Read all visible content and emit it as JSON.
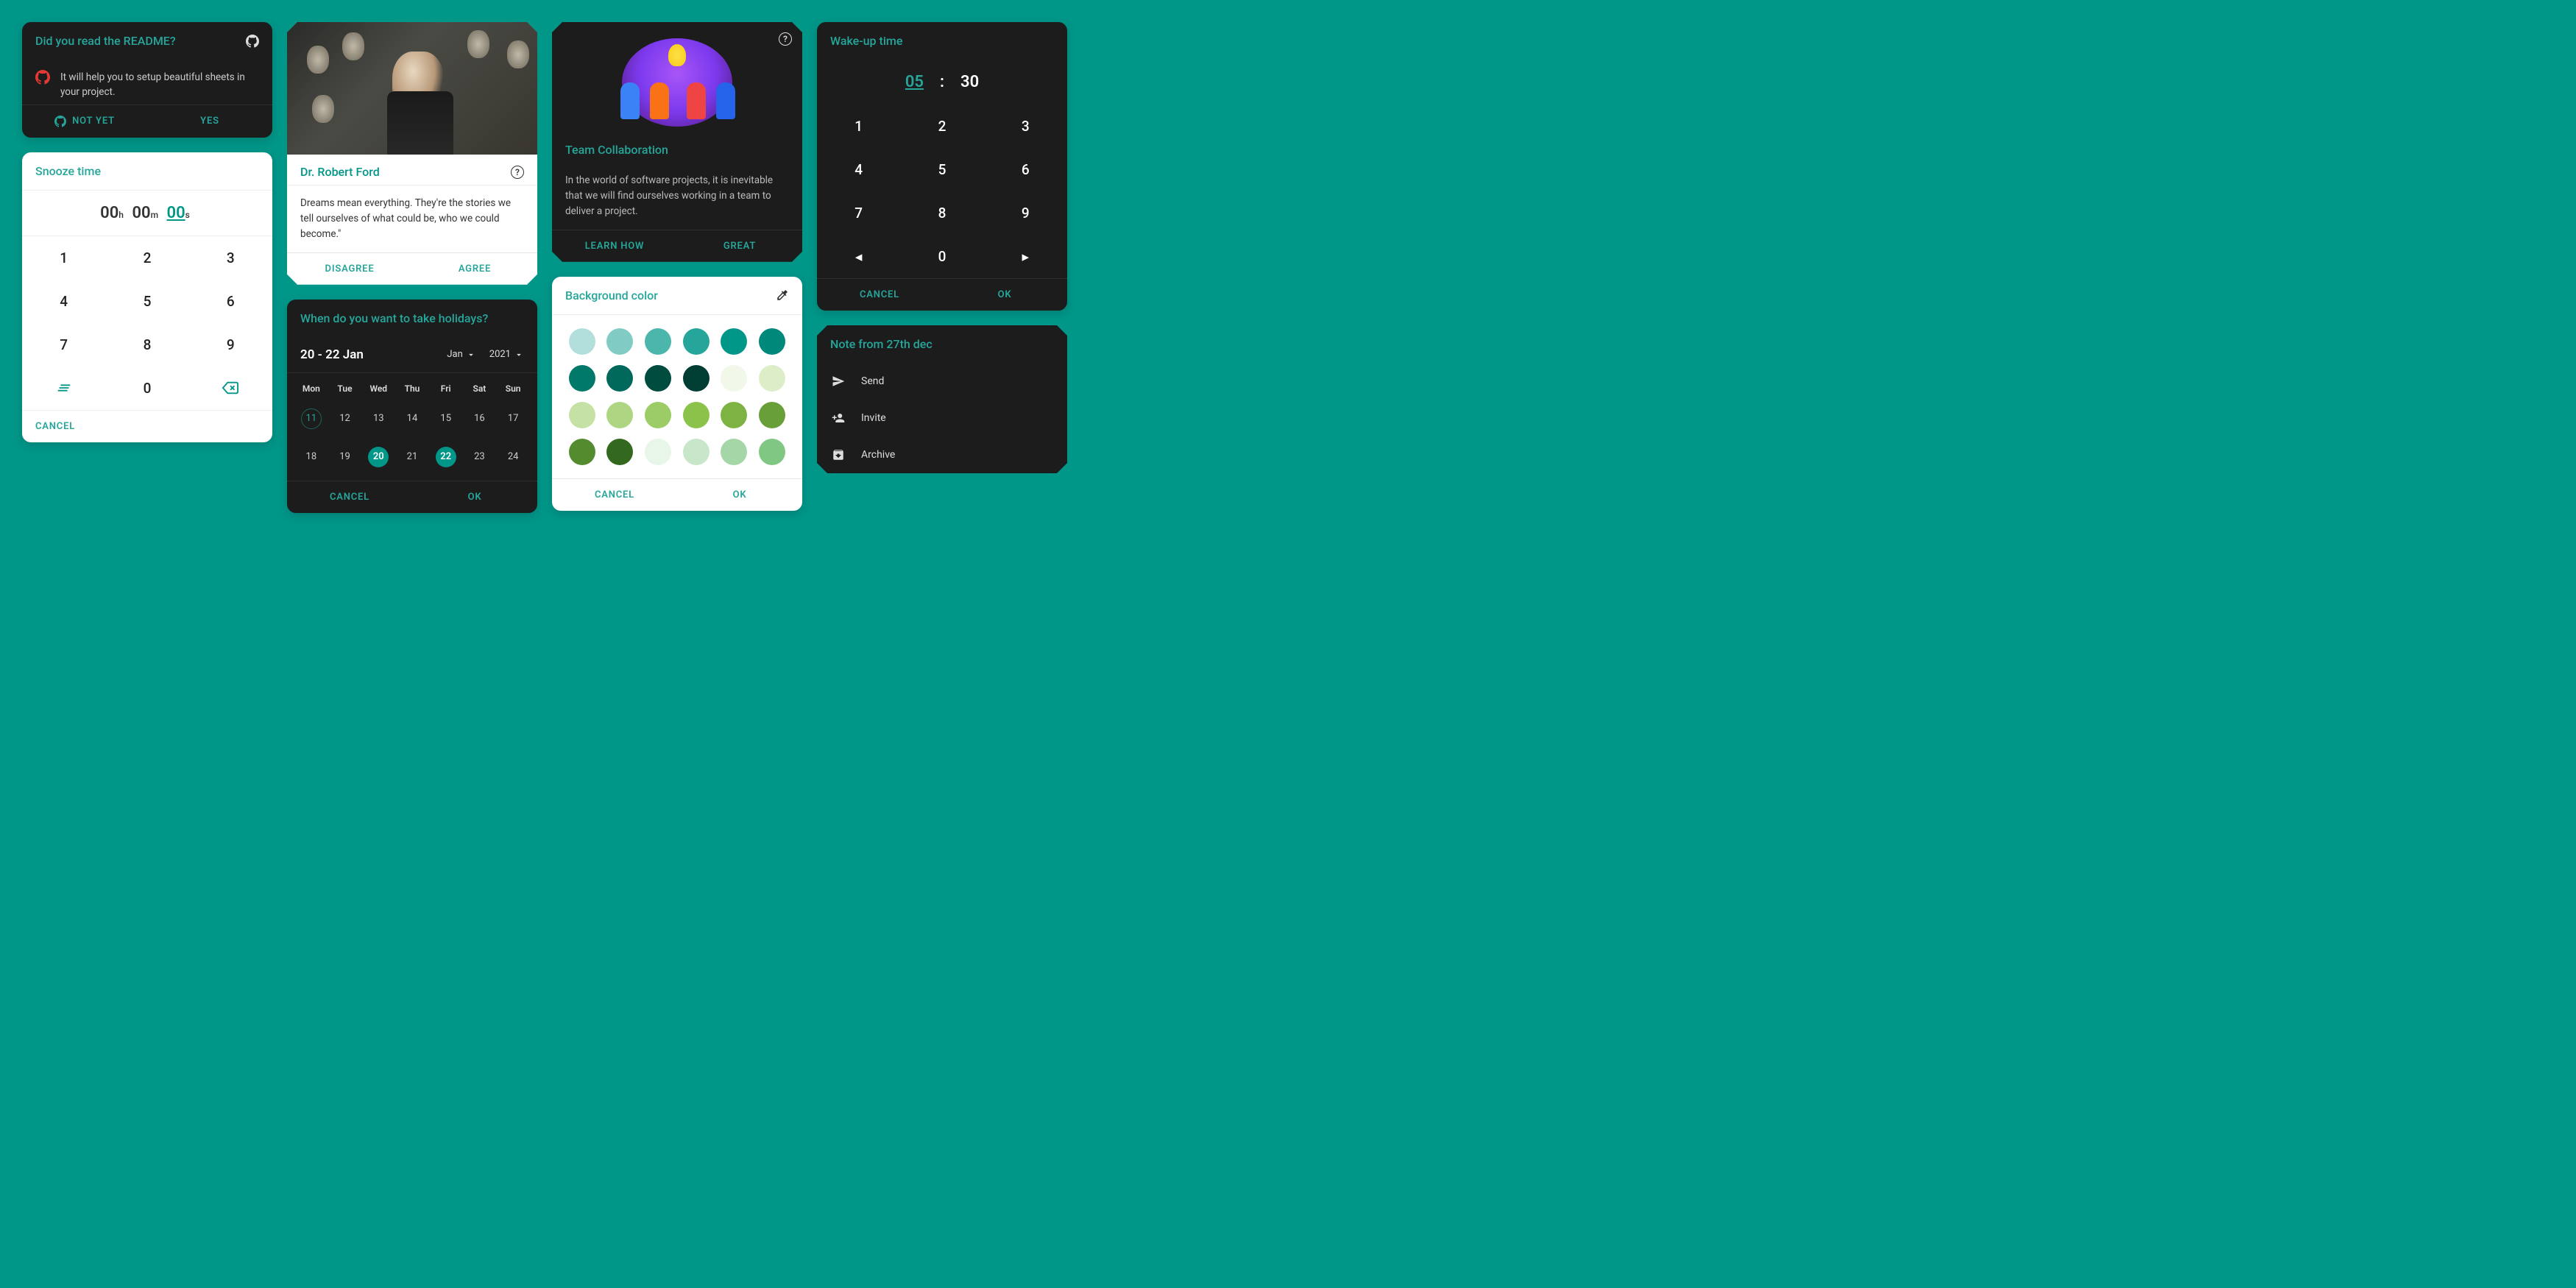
{
  "readme": {
    "title": "Did you read the README?",
    "body": "It will help you to setup beautiful sheets in your project.",
    "not_yet": "NOT YET",
    "yes": "YES"
  },
  "snooze": {
    "title": "Snooze time",
    "h": "00",
    "m": "00",
    "s": "00",
    "h_unit": "h",
    "m_unit": "m",
    "s_unit": "s",
    "cancel": "CANCEL"
  },
  "numpad": [
    "1",
    "2",
    "3",
    "4",
    "5",
    "6",
    "7",
    "8",
    "9"
  ],
  "numpad_zero": "0",
  "ford": {
    "name": "Dr. Robert Ford",
    "quote": "Dreams mean everything. They're the stories we tell ourselves of what could be, who we could become.\"",
    "disagree": "DISAGREE",
    "agree": "AGREE"
  },
  "holidays": {
    "title": "When do you want to take holidays?",
    "range": "20 - 22 Jan",
    "month": "Jan",
    "year": "2021",
    "days": [
      "Mon",
      "Tue",
      "Wed",
      "Thu",
      "Fri",
      "Sat",
      "Sun"
    ],
    "week1": [
      "11",
      "12",
      "13",
      "14",
      "15",
      "16",
      "17"
    ],
    "week2": [
      "18",
      "19",
      "20",
      "21",
      "22",
      "23",
      "24"
    ],
    "today": "11",
    "selected": [
      "20",
      "22"
    ],
    "cancel": "CANCEL",
    "ok": "OK"
  },
  "team": {
    "title": "Team Collaboration",
    "body": "In the world of software projects, it is inevitable that we will find ourselves working in a team to deliver a project.",
    "learn": "LEARN HOW",
    "great": "GREAT"
  },
  "colors_card": {
    "title": "Background color",
    "cancel": "CANCEL",
    "ok": "OK",
    "swatches": [
      "#b2dfdb",
      "#80cbc4",
      "#4db6ac",
      "#26a69a",
      "#009688",
      "#00897b",
      "#00796b",
      "#00695c",
      "#004d40",
      "#003d33",
      "#f1f8e9",
      "#dcedc8",
      "#c5e1a5",
      "#aed581",
      "#9ccc65",
      "#8bc34a",
      "#7cb342",
      "#689f38",
      "#558b2f",
      "#33691e",
      "#e8f5e9",
      "#c8e6c9",
      "#a5d6a7",
      "#81c784"
    ]
  },
  "wake": {
    "title": "Wake-up time",
    "hour": "05",
    "sep": ":",
    "min": "30",
    "cancel": "CANCEL",
    "ok": "OK"
  },
  "note": {
    "title": "Note from 27th dec",
    "send": "Send",
    "invite": "Invite",
    "archive": "Archive"
  }
}
